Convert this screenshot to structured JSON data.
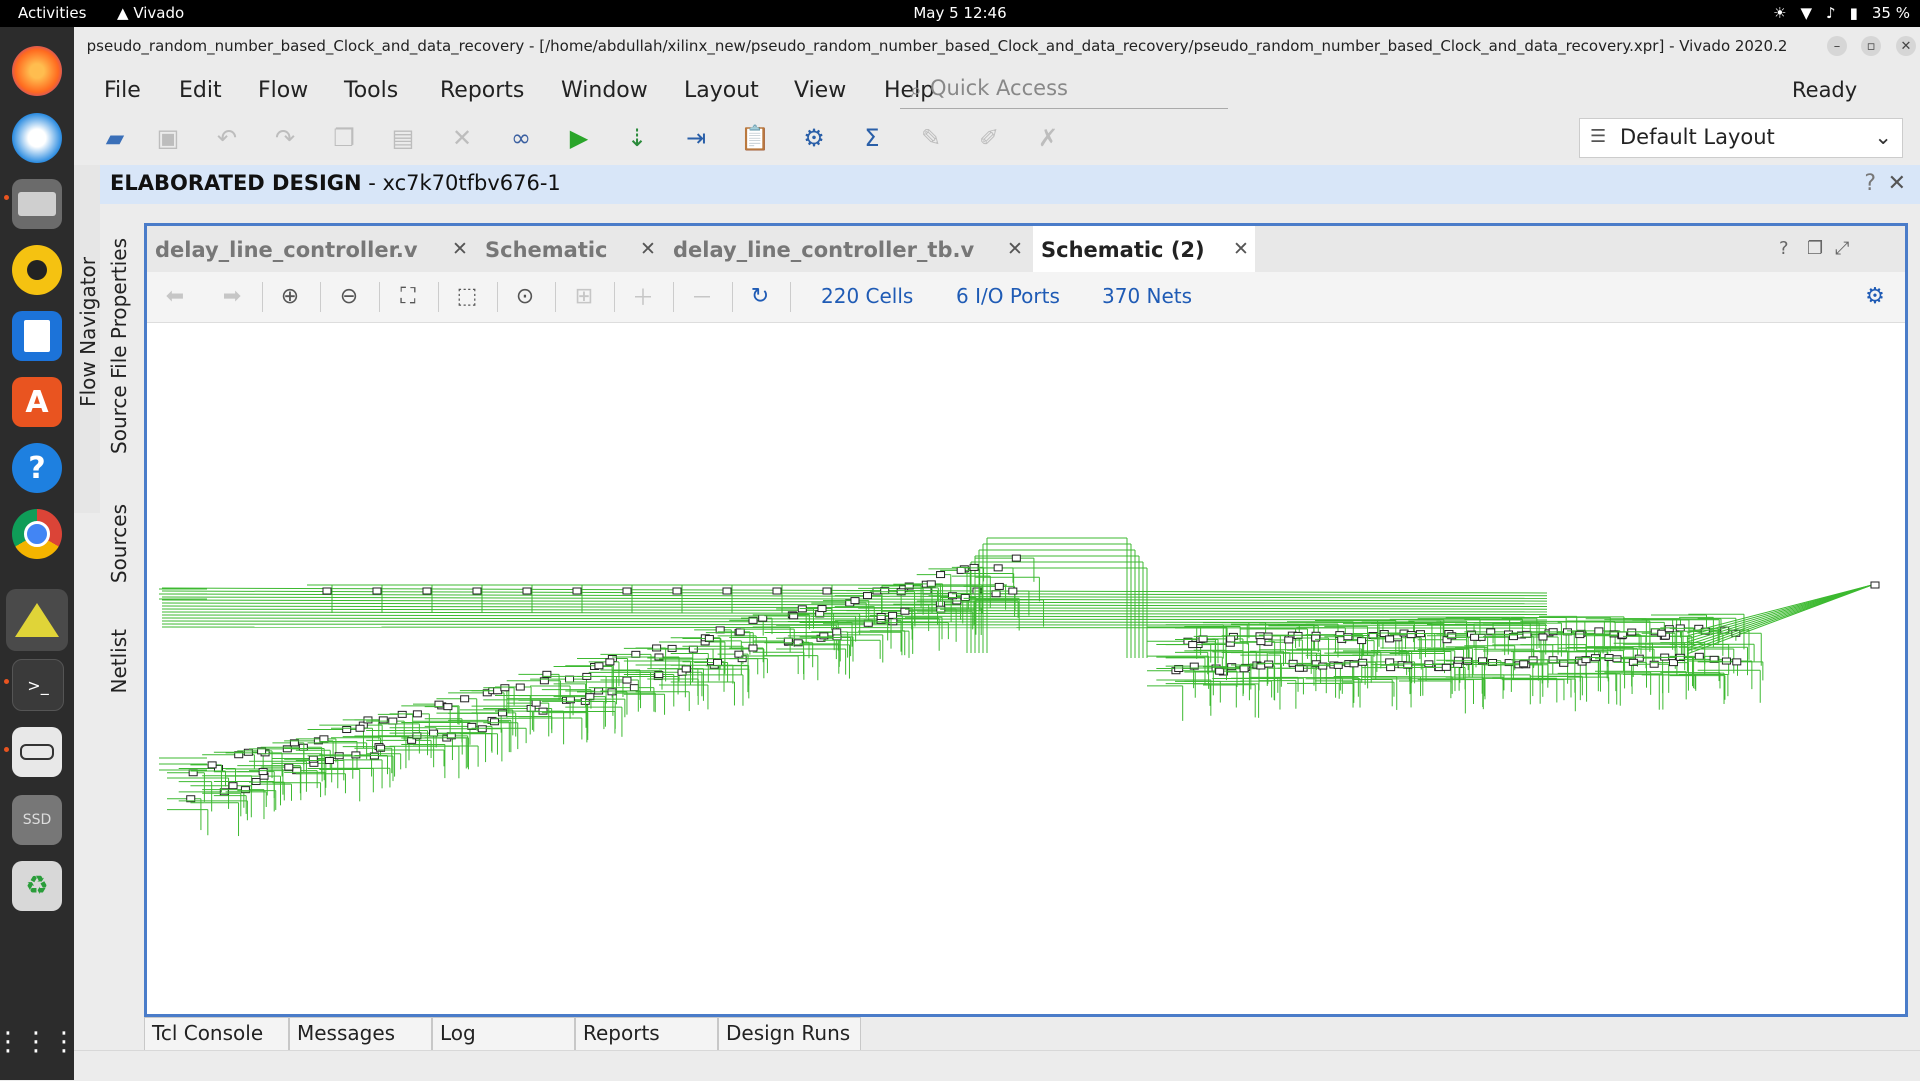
{
  "topbar": {
    "activities": "Activities",
    "app": "Vivado",
    "clock": "May 5  12:46",
    "battery": "35 %"
  },
  "window": {
    "title": "pseudo_random_number_based_Clock_and_data_recovery - [/home/abdullah/xilinx_new/pseudo_random_number_based_Clock_and_data_recovery/pseudo_random_number_based_Clock_and_data_recovery.xpr] - Vivado 2020.2"
  },
  "menu": {
    "items": [
      "File",
      "Edit",
      "Flow",
      "Tools",
      "Reports",
      "Window",
      "Layout",
      "View",
      "Help"
    ],
    "quick_access_placeholder": "Quick Access",
    "status": "Ready"
  },
  "toolbar": {
    "layout_value": "Default Layout"
  },
  "design": {
    "label": "ELABORATED DESIGN",
    "part": "- xc7k70tfbv676-1"
  },
  "side_tabs": {
    "flow_navigator": "Flow Navigator",
    "source_file_properties": "Source File Properties",
    "sources": "Sources",
    "netlist": "Netlist"
  },
  "tabs": [
    {
      "label": "delay_line_controller.v"
    },
    {
      "label": "Schematic"
    },
    {
      "label": "delay_line_controller_tb.v"
    },
    {
      "label": "Schematic (2)"
    }
  ],
  "schematic": {
    "cells": "220 Cells",
    "io_ports": "6 I/O Ports",
    "nets": "370 Nets"
  },
  "bottom_tabs": [
    "Tcl Console",
    "Messages",
    "Log",
    "Reports",
    "Design Runs"
  ],
  "colors": {
    "accent": "#4a7cc9",
    "design_bar": "#d8e6f8",
    "net": "#3cb930",
    "link": "#1f5bb5"
  }
}
